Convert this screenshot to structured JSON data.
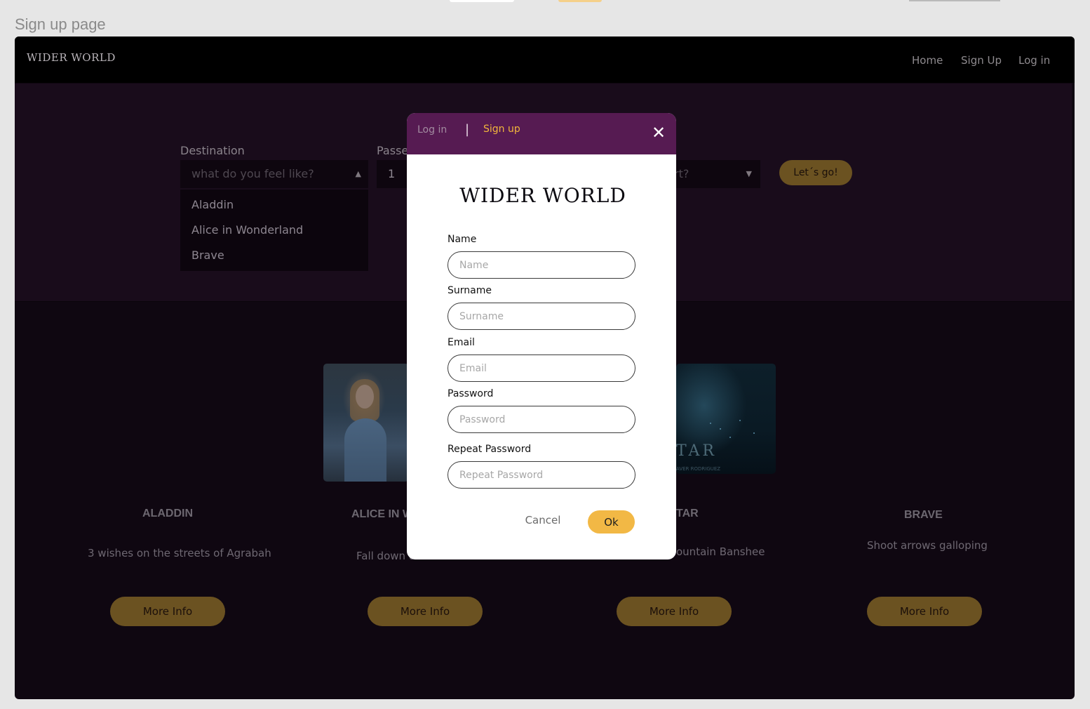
{
  "page_caption": "Sign up page",
  "navbar": {
    "brand": "WIDER WORLD",
    "links": [
      "Home",
      "Sign Up",
      "Log in"
    ]
  },
  "search": {
    "destination_label": "Destination",
    "destination_placeholder": "what do you feel like?",
    "destination_options": [
      "Aladdin",
      "Alice in Wonderland",
      "Brave"
    ],
    "passengers_label": "Passe",
    "passengers_value": "1",
    "third_select_placeholder": "rt?",
    "go_button": "Let´s go!"
  },
  "cards": [
    {
      "title": "ALADDIN",
      "description": "3 wishes on the streets of Agrabah",
      "button": "More Info"
    },
    {
      "title": "ALICE IN W",
      "description": "Fall down t",
      "button": "More Info"
    },
    {
      "title": "TAR",
      "description": "ountain Banshee",
      "button": "More Info"
    },
    {
      "title": "BRAVE",
      "description": "Shoot arrows galloping",
      "button": "More Info"
    }
  ],
  "avatar_poster": {
    "title_text": "TAR",
    "credits_text": "AVER RODRIGUEZ"
  },
  "modal": {
    "tab_login": "Log in",
    "tab_separator": "|",
    "tab_signup": "Sign up",
    "close_icon": "close-icon",
    "logo": "WIDER WORLD",
    "fields": [
      {
        "label": "Name",
        "placeholder": "Name"
      },
      {
        "label": "Surname",
        "placeholder": "Surname"
      },
      {
        "label": "Email",
        "placeholder": "Email"
      },
      {
        "label": "Password",
        "placeholder": "Password"
      },
      {
        "label": "Repeat Password",
        "placeholder": "Repeat Password"
      }
    ],
    "cancel": "Cancel",
    "ok": "Ok"
  },
  "colors": {
    "modal_header": "#561b52",
    "accent_yellow": "#f2b845",
    "dim_gold": "#6b5221",
    "backdrop": "#0f0711"
  }
}
